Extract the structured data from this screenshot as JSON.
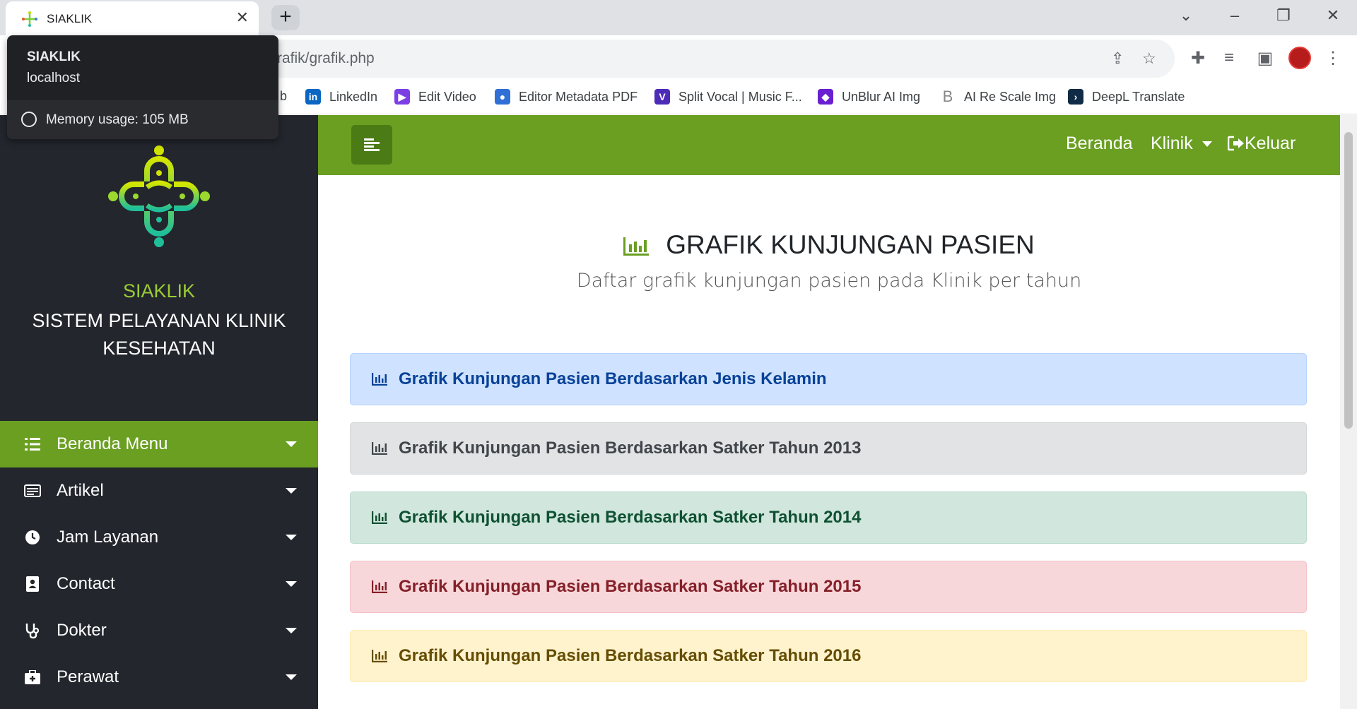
{
  "browser": {
    "tab_title": "SIAKLIK",
    "url": "rafik/grafik.php",
    "tooltip": {
      "title": "SIAKLIK",
      "host": "localhost",
      "memory": "Memory usage: 105 MB"
    },
    "bookmarks": [
      {
        "label": "b",
        "icon": "bookmark-partial"
      },
      {
        "label": "LinkedIn",
        "icon": "linkedin-icon",
        "color": "#0a66c2"
      },
      {
        "label": "Edit Video",
        "icon": "video-icon",
        "color": "#7b3fe4"
      },
      {
        "label": "Editor Metadata PDF",
        "icon": "people-icon",
        "color": "#2f6fd6"
      },
      {
        "label": "Split Vocal | Music F...",
        "icon": "v-icon",
        "color": "#4c2bb8"
      },
      {
        "label": "UnBlur AI Img",
        "icon": "unblur-icon",
        "color": "#6a1fd0"
      },
      {
        "label": "AI Re Scale Img",
        "icon": "b-icon",
        "color": "#888888"
      },
      {
        "label": "DeepL Translate",
        "icon": "deepl-icon",
        "color": "#0f2b46"
      }
    ]
  },
  "sidebar": {
    "brand": "SIAKLIK",
    "brand_sub": "SISTEM PELAYANAN KLINIK KESEHATAN",
    "items": [
      {
        "label": "Beranda Menu",
        "icon": "list-icon",
        "active": true
      },
      {
        "label": "Artikel",
        "icon": "newspaper-icon"
      },
      {
        "label": "Jam Layanan",
        "icon": "clock-icon"
      },
      {
        "label": "Contact",
        "icon": "contact-icon"
      },
      {
        "label": "Dokter",
        "icon": "stethoscope-icon"
      },
      {
        "label": "Perawat",
        "icon": "medkit-icon"
      }
    ]
  },
  "navbar": {
    "beranda": "Beranda",
    "klinik": "Klinik",
    "keluar": "Keluar"
  },
  "content": {
    "title": "GRAFIK KUNJUNGAN PASIEN",
    "subtitle": "Daftar grafik kunjungan pasien pada Klinik per tahun",
    "cards": [
      {
        "label": "Grafik Kunjungan Pasien Berdasarkan Jenis Kelamin",
        "bg": "#cfe2ff",
        "border": "#b6d4fe",
        "color": "#084298"
      },
      {
        "label": "Grafik Kunjungan Pasien Berdasarkan Satker Tahun 2013",
        "bg": "#e2e3e5",
        "border": "#d3d6d8",
        "color": "#41464b"
      },
      {
        "label": "Grafik Kunjungan Pasien Berdasarkan Satker Tahun 2014",
        "bg": "#d1e7dd",
        "border": "#badbcc",
        "color": "#0f5132"
      },
      {
        "label": "Grafik Kunjungan Pasien Berdasarkan Satker Tahun 2015",
        "bg": "#f8d7da",
        "border": "#f5c2c7",
        "color": "#842029"
      },
      {
        "label": "Grafik Kunjungan Pasien Berdasarkan Satker Tahun 2016",
        "bg": "#fff3cd",
        "border": "#ffecb5",
        "color": "#664d03"
      }
    ]
  },
  "colors": {
    "accent": "#6a9f22",
    "sidebar_bg": "#23262d",
    "brand_green": "#9acd32"
  }
}
